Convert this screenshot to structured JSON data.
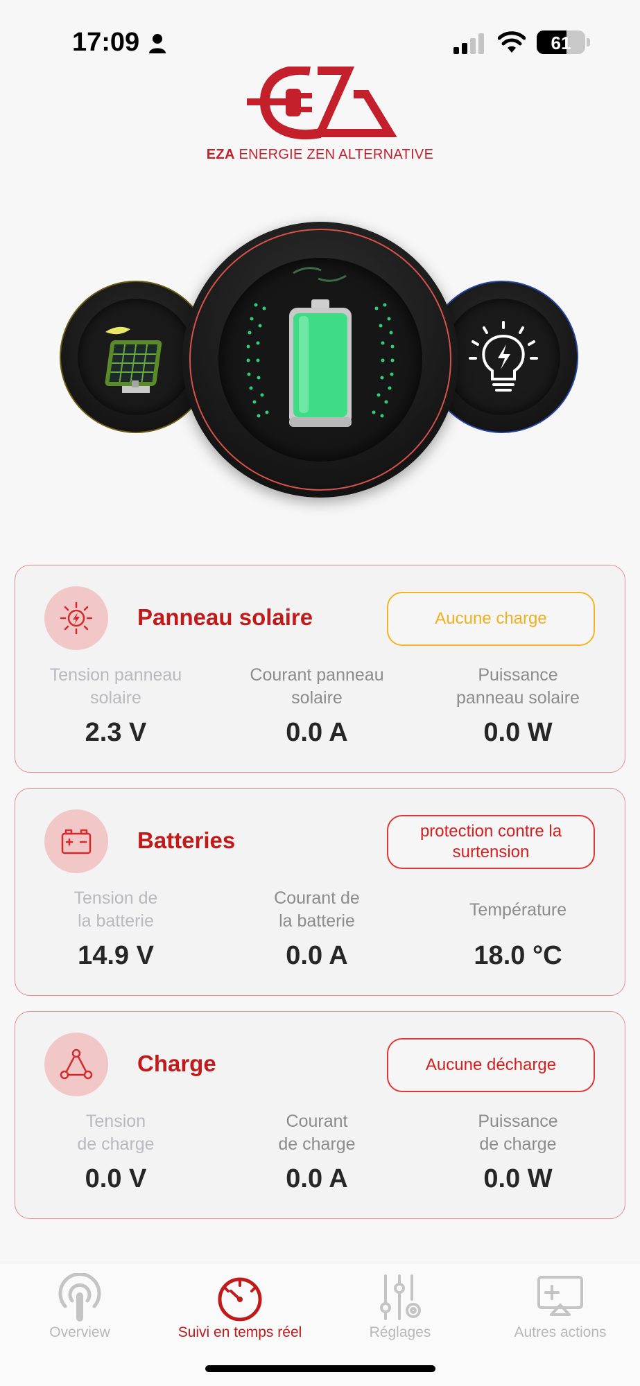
{
  "status_bar": {
    "time": "17:09",
    "battery_level": "61"
  },
  "brand": {
    "short": "EZA",
    "name": "ENERGIE ZEN ALTERNATIVE"
  },
  "colors": {
    "accent": "#c01a1a",
    "yellow_badge": "#efb020",
    "red_badge": "#d62020"
  },
  "gauges": {
    "left_icon": "solar-panel-icon",
    "center_icon": "battery-icon",
    "right_icon": "lightbulb-icon"
  },
  "cards": [
    {
      "icon": "sun-bolt-icon",
      "title": "Panneau solaire",
      "badge": "Aucune charge",
      "badge_style": "yellow",
      "metrics": [
        {
          "label": "Tension panneau\nsolaire",
          "value": "2.3 V"
        },
        {
          "label": "Courant panneau\nsolaire",
          "value": "0.0 A"
        },
        {
          "label": "Puissance\npanneau solaire",
          "value": "0.0 W"
        }
      ]
    },
    {
      "icon": "car-battery-icon",
      "title": "Batteries",
      "badge": "protection contre la surtension",
      "badge_style": "red",
      "metrics": [
        {
          "label": "Tension de\nla batterie",
          "value": "14.9 V"
        },
        {
          "label": "Courant de\nla batterie",
          "value": "0.0 A"
        },
        {
          "label": "Température",
          "value": "18.0 °C"
        }
      ]
    },
    {
      "icon": "triangle-nodes-icon",
      "title": "Charge",
      "badge": "Aucune décharge",
      "badge_style": "red",
      "metrics": [
        {
          "label": "Tension\nde charge",
          "value": "0.0 V"
        },
        {
          "label": "Courant\nde charge",
          "value": "0.0 A"
        },
        {
          "label": "Puissance\nde charge",
          "value": "0.0 W"
        }
      ]
    }
  ],
  "tabs": [
    {
      "label": "Overview",
      "icon": "broadcast-icon",
      "active": false
    },
    {
      "label": "Suivi en temps réel",
      "icon": "speedometer-icon",
      "active": true
    },
    {
      "label": "Réglages",
      "icon": "sliders-gear-icon",
      "active": false
    },
    {
      "label": "Autres actions",
      "icon": "screen-upload-icon",
      "active": false
    }
  ]
}
